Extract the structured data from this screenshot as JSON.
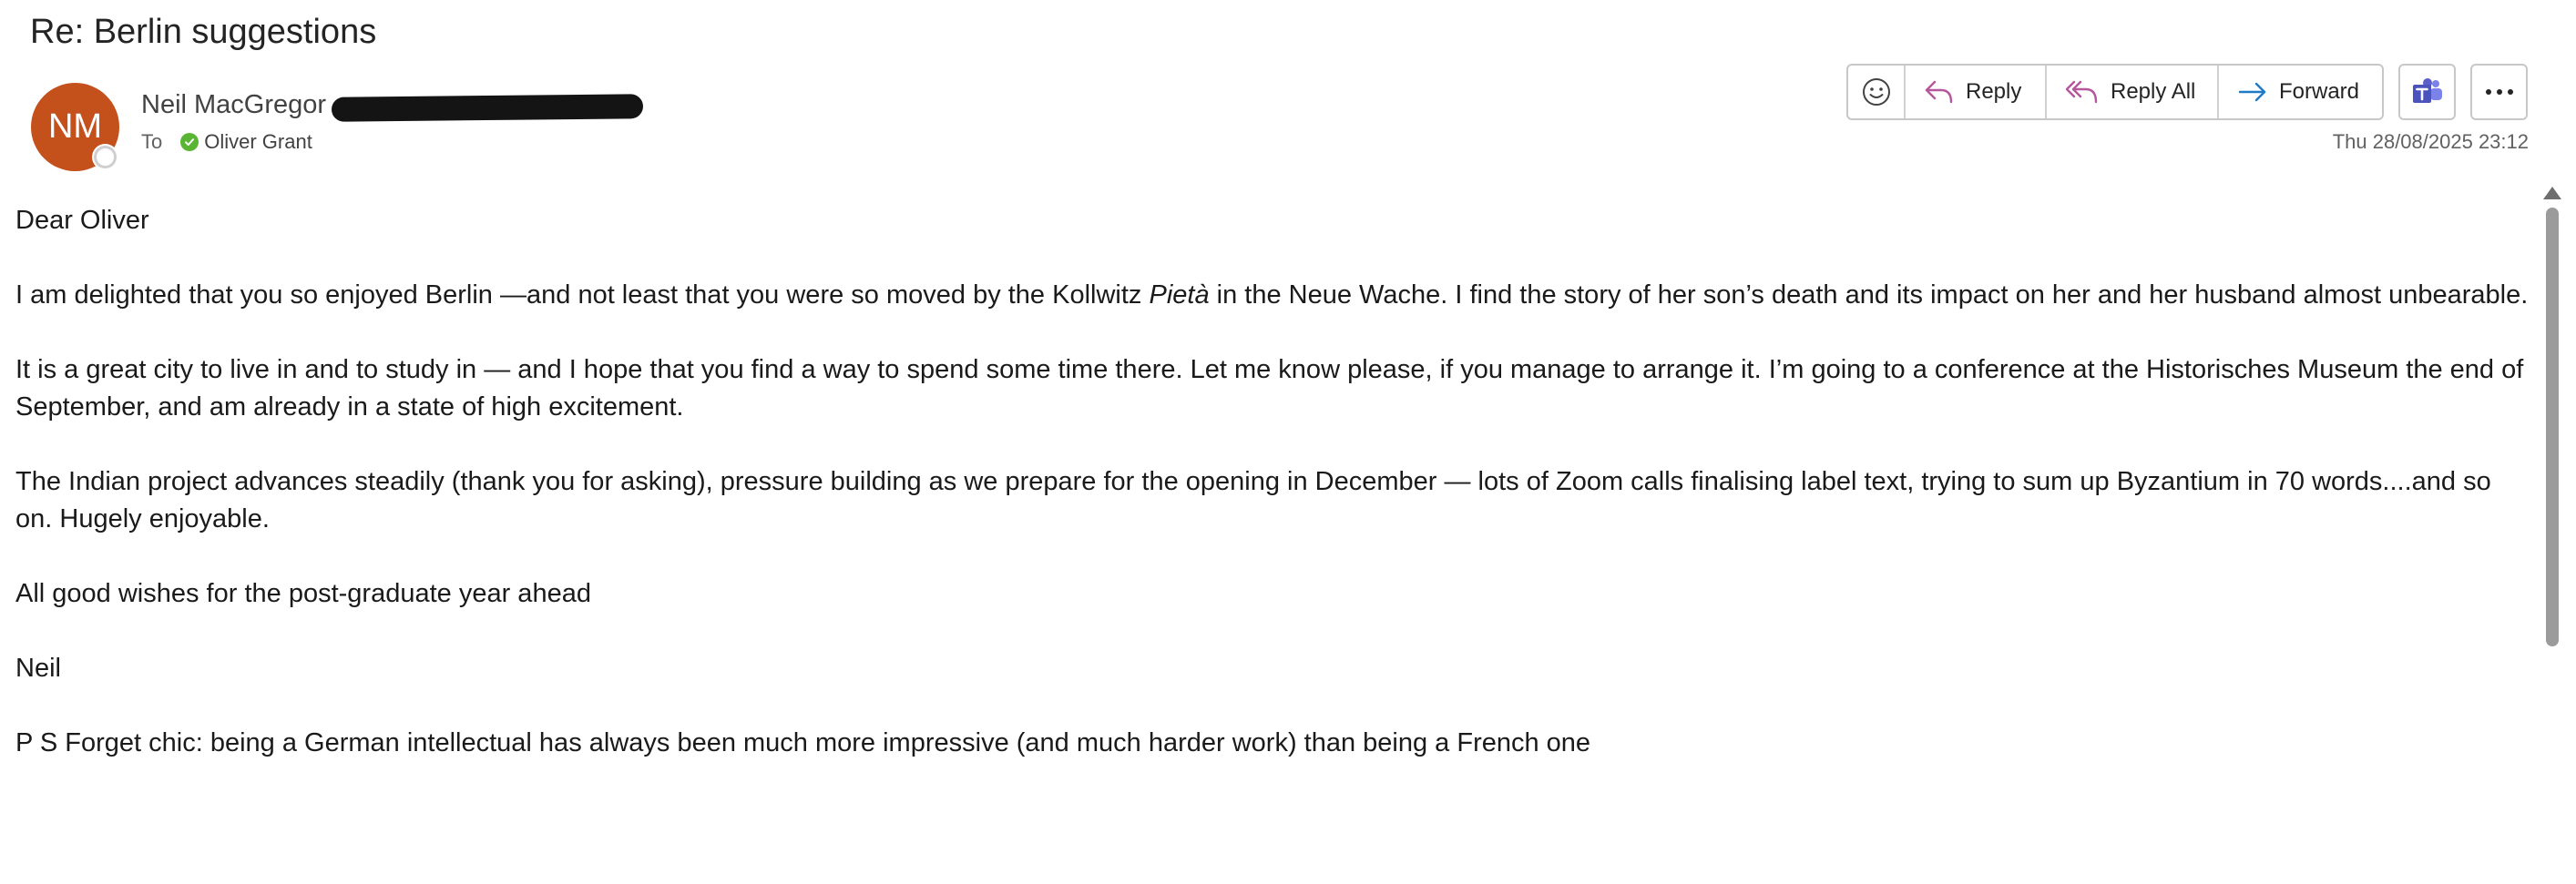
{
  "email": {
    "subject": "Re: Berlin suggestions",
    "sender": {
      "initials": "NM",
      "name": "Neil MacGregor"
    },
    "to_label": "To",
    "recipient": "Oliver Grant",
    "timestamp": "Thu 28/08/2025 23:12"
  },
  "toolbar": {
    "reply_label": "Reply",
    "reply_all_label": "Reply All",
    "forward_label": "Forward"
  },
  "icons": {
    "emoji": "smiley-icon",
    "reply": "reply-arrow-icon",
    "reply_all": "reply-all-arrow-icon",
    "forward": "forward-arrow-icon",
    "teams": "teams-icon",
    "more": "ellipsis-icon"
  },
  "colors": {
    "avatar": "#c4501b",
    "reply_icon": "#b4579b",
    "forward_icon": "#1f7ac6",
    "teams": "#5b5fc7",
    "presence_available": "#5ab534"
  },
  "body": {
    "greeting": "Dear Oliver",
    "p1_a": "I am delighted that you so enjoyed Berlin —and  not least that you were so moved by the Kollwitz ",
    "p1_em": "Pietà",
    "p1_b": " in the Neue Wache.  I find the story of her son’s death  and its impact on her and  her husband almost unbearable.",
    "p2": "It is a great city to live in and to study in — and I hope that you find a way to spend some time there.  Let me know please, if you manage to arrange it.   I’m going to a conference at the Historisches Museum the end of September, and am already in a state of high excitement.",
    "p3": "The Indian project advances steadily (thank you for asking), pressure building as we prepare for the opening in December — lots of Zoom calls finalising label text, trying to sum up Byzantium in 70 words....and so on.  Hugely enjoyable.",
    "p4": "All good wishes for the post-graduate year ahead",
    "signoff": "Neil",
    "ps": "P S  Forget chic: being a German intellectual has always been much more impressive (and much harder work) than being a French one"
  }
}
